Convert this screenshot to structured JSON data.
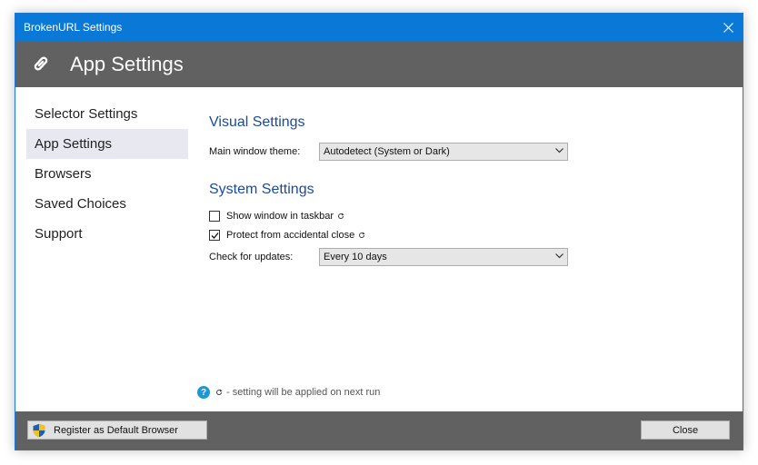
{
  "window": {
    "title": "BrokenURL Settings"
  },
  "header": {
    "title": "App Settings",
    "icon": "link-icon"
  },
  "sidebar": {
    "items": [
      {
        "label": "Selector Settings",
        "active": false
      },
      {
        "label": "App Settings",
        "active": true
      },
      {
        "label": "Browsers",
        "active": false
      },
      {
        "label": "Saved Choices",
        "active": false
      },
      {
        "label": "Support",
        "active": false
      }
    ]
  },
  "visual": {
    "title": "Visual Settings",
    "theme_label": "Main window theme:",
    "theme_value": "Autodetect (System or Dark)"
  },
  "system": {
    "title": "System Settings",
    "taskbar_label": "Show window in taskbar",
    "taskbar_checked": false,
    "protect_label": "Protect from accidental close",
    "protect_checked": true,
    "updates_label": "Check for updates:",
    "updates_value": "Every 10 days"
  },
  "note": {
    "text": "- setting will be applied on next run"
  },
  "footer": {
    "register_label": "Register as Default Browser",
    "close_label": "Close"
  },
  "colors": {
    "titlebar": "#0a78d7",
    "header": "#616161",
    "section_title": "#1c4a9c",
    "active_nav": "#e8e8f0"
  }
}
